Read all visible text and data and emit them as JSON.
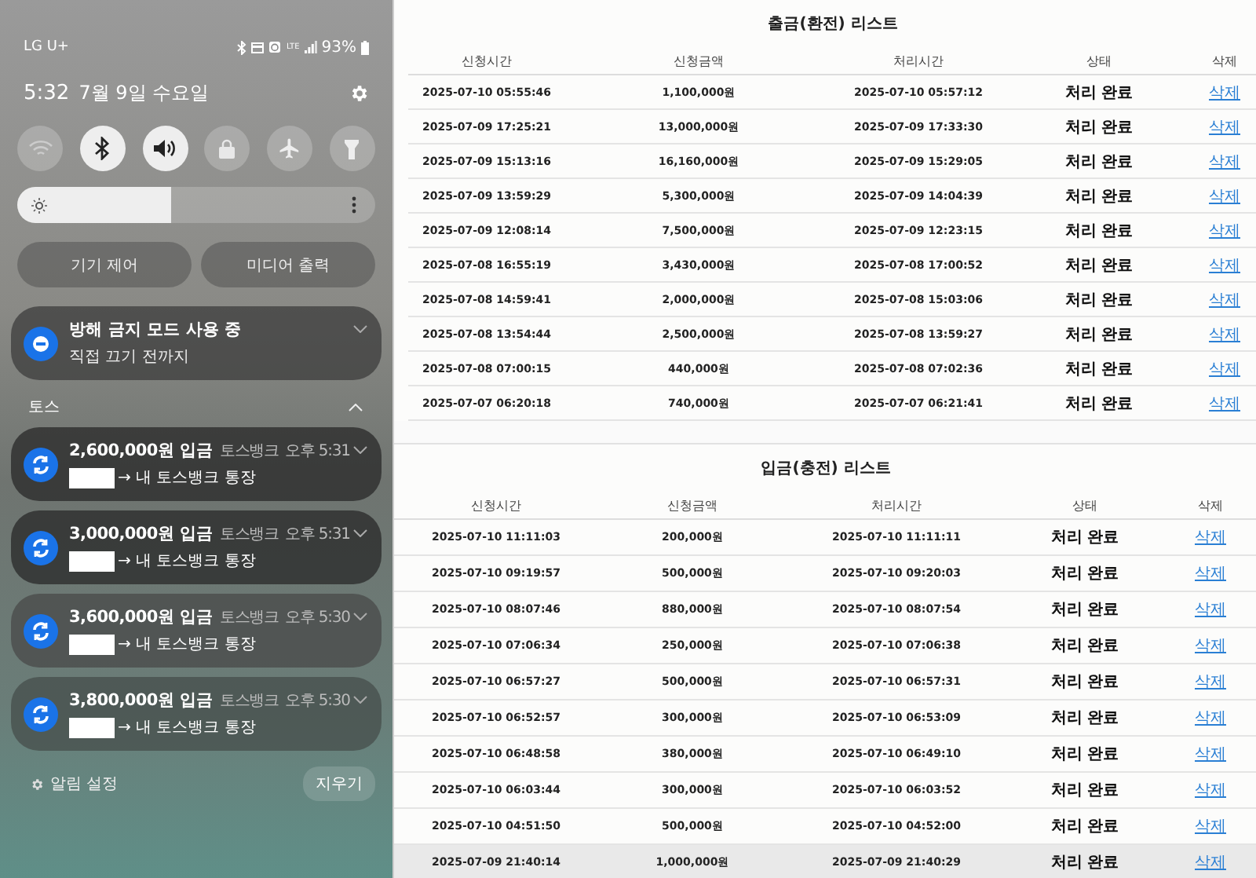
{
  "phone": {
    "status_bar": {
      "carrier": "LG U+",
      "battery": "93%",
      "network": "LTE"
    },
    "header": {
      "time": "5:32",
      "date": "7월 9일 수요일"
    },
    "quick_toggles": [
      {
        "kind": "wifi",
        "on": false
      },
      {
        "kind": "bluetooth",
        "on": true
      },
      {
        "kind": "sound",
        "on": true
      },
      {
        "kind": "lock",
        "on": false
      },
      {
        "kind": "airplane",
        "on": false
      },
      {
        "kind": "flashlight",
        "on": false
      }
    ],
    "brightness": {
      "level": 0.43
    },
    "buttons": [
      "기기 제어",
      "미디어 출력"
    ],
    "dnd": {
      "title": "방해 금지 모드 사용 중",
      "subtitle": "직접 끄기 전까지"
    },
    "group": {
      "name": "토스",
      "expanded": true
    },
    "notifications": [
      {
        "title": "2,600,000원 입금",
        "app": "토스뱅크",
        "time": "오후 5:31",
        "body": "→ 내 토스뱅크 통장"
      },
      {
        "title": "3,000,000원 입금",
        "app": "토스뱅크",
        "time": "오후 5:31",
        "body": "→ 내 토스뱅크 통장"
      },
      {
        "title": "3,600,000원 입금",
        "app": "토스뱅크",
        "time": "오후 5:30",
        "body": "→ 내 토스뱅크 통장"
      },
      {
        "title": "3,800,000원 입금",
        "app": "토스뱅크",
        "time": "오후 5:30",
        "body": "→ 내 토스뱅크 통장"
      }
    ],
    "footer": {
      "settings": "알림 설정",
      "clear": "지우기"
    }
  },
  "withdrawals": {
    "title": "출금(환전) 리스트",
    "columns": [
      "신청시간",
      "신청금액",
      "처리시간",
      "상태",
      "삭제"
    ],
    "rows": [
      [
        "2025-07-10 05:55:46",
        "1,100,000원",
        "2025-07-10 05:57:12",
        "처리 완료",
        "삭제"
      ],
      [
        "2025-07-09 17:25:21",
        "13,000,000원",
        "2025-07-09 17:33:30",
        "처리 완료",
        "삭제"
      ],
      [
        "2025-07-09 15:13:16",
        "16,160,000원",
        "2025-07-09 15:29:05",
        "처리 완료",
        "삭제"
      ],
      [
        "2025-07-09 13:59:29",
        "5,300,000원",
        "2025-07-09 14:04:39",
        "처리 완료",
        "삭제"
      ],
      [
        "2025-07-09 12:08:14",
        "7,500,000원",
        "2025-07-09 12:23:15",
        "처리 완료",
        "삭제"
      ],
      [
        "2025-07-08 16:55:19",
        "3,430,000원",
        "2025-07-08 17:00:52",
        "처리 완료",
        "삭제"
      ],
      [
        "2025-07-08 14:59:41",
        "2,000,000원",
        "2025-07-08 15:03:06",
        "처리 완료",
        "삭제"
      ],
      [
        "2025-07-08 13:54:44",
        "2,500,000원",
        "2025-07-08 13:59:27",
        "처리 완료",
        "삭제"
      ],
      [
        "2025-07-08 07:00:15",
        "440,000원",
        "2025-07-08 07:02:36",
        "처리 완료",
        "삭제"
      ],
      [
        "2025-07-07 06:20:18",
        "740,000원",
        "2025-07-07 06:21:41",
        "처리 완료",
        "삭제"
      ]
    ]
  },
  "deposits": {
    "title": "입금(충전) 리스트",
    "columns": [
      "신청시간",
      "신청금액",
      "처리시간",
      "상태",
      "삭제"
    ],
    "rows": [
      {
        "cells": [
          "2025-07-10 11:11:03",
          "200,000원",
          "2025-07-10 11:11:11",
          "처리 완료",
          "삭제"
        ],
        "highlighted": false
      },
      {
        "cells": [
          "2025-07-10 09:19:57",
          "500,000원",
          "2025-07-10 09:20:03",
          "처리 완료",
          "삭제"
        ],
        "highlighted": false
      },
      {
        "cells": [
          "2025-07-10 08:07:46",
          "880,000원",
          "2025-07-10 08:07:54",
          "처리 완료",
          "삭제"
        ],
        "highlighted": false
      },
      {
        "cells": [
          "2025-07-10 07:06:34",
          "250,000원",
          "2025-07-10 07:06:38",
          "처리 완료",
          "삭제"
        ],
        "highlighted": false
      },
      {
        "cells": [
          "2025-07-10 06:57:27",
          "500,000원",
          "2025-07-10 06:57:31",
          "처리 완료",
          "삭제"
        ],
        "highlighted": false
      },
      {
        "cells": [
          "2025-07-10 06:52:57",
          "300,000원",
          "2025-07-10 06:53:09",
          "처리 완료",
          "삭제"
        ],
        "highlighted": false
      },
      {
        "cells": [
          "2025-07-10 06:48:58",
          "380,000원",
          "2025-07-10 06:49:10",
          "처리 완료",
          "삭제"
        ],
        "highlighted": false
      },
      {
        "cells": [
          "2025-07-10 06:03:44",
          "300,000원",
          "2025-07-10 06:03:52",
          "처리 완료",
          "삭제"
        ],
        "highlighted": false
      },
      {
        "cells": [
          "2025-07-10 04:51:50",
          "500,000원",
          "2025-07-10 04:52:00",
          "처리 완료",
          "삭제"
        ],
        "highlighted": false
      },
      {
        "cells": [
          "2025-07-09 21:40:14",
          "1,000,000원",
          "2025-07-09 21:40:29",
          "처리 완료",
          "삭제"
        ],
        "highlighted": true
      }
    ]
  }
}
